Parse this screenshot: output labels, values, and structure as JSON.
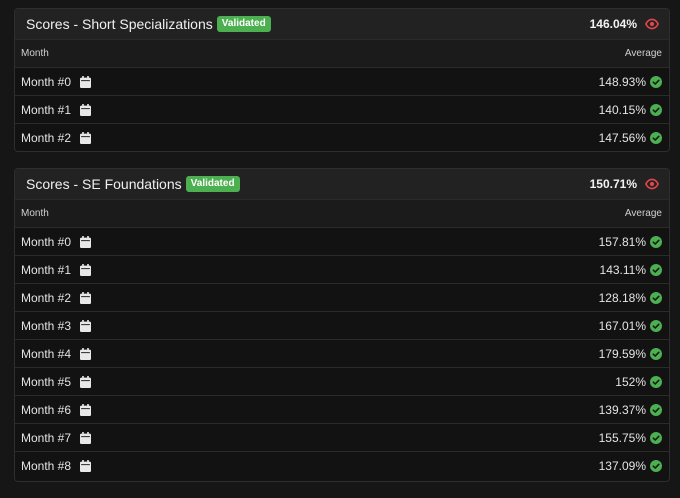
{
  "sections": [
    {
      "title": "Scores - Short Specializations",
      "badge": "Validated",
      "header_value": "146.04%",
      "columns": {
        "left": "Month",
        "right": "Average"
      },
      "rows": [
        {
          "month": "Month #0",
          "average": "148.93%"
        },
        {
          "month": "Month #1",
          "average": "140.15%"
        },
        {
          "month": "Month #2",
          "average": "147.56%"
        }
      ]
    },
    {
      "title": "Scores - SE Foundations",
      "badge": "Validated",
      "header_value": "150.71%",
      "columns": {
        "left": "Month",
        "right": "Average"
      },
      "rows": [
        {
          "month": "Month #0",
          "average": "157.81%"
        },
        {
          "month": "Month #1",
          "average": "143.11%"
        },
        {
          "month": "Month #2",
          "average": "128.18%"
        },
        {
          "month": "Month #3",
          "average": "167.01%"
        },
        {
          "month": "Month #4",
          "average": "179.59%"
        },
        {
          "month": "Month #5",
          "average": "152%"
        },
        {
          "month": "Month #6",
          "average": "139.37%"
        },
        {
          "month": "Month #7",
          "average": "155.75%"
        },
        {
          "month": "Month #8",
          "average": "137.09%"
        }
      ]
    }
  ],
  "icons": {
    "header": "eye-icon",
    "row_left": "calendar-icon",
    "row_right": "check-circle-icon"
  },
  "colors": {
    "badge": "#4caf50",
    "eye": "#e0464b",
    "check": "#4caf50"
  }
}
